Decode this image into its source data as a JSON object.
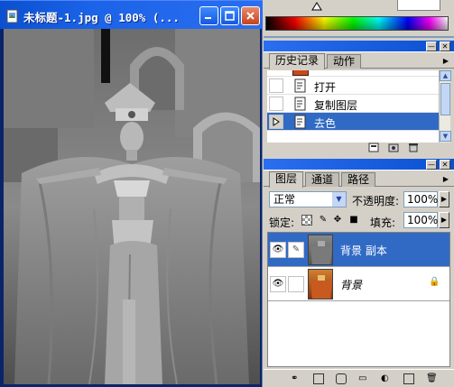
{
  "document": {
    "title": "未标题-1.jpg @ 100% (..."
  },
  "history": {
    "tabs": [
      "历史记录",
      "动作"
    ],
    "items": [
      {
        "label": "打开",
        "selected": false
      },
      {
        "label": "复制图层",
        "selected": false
      },
      {
        "label": "去色",
        "selected": true
      }
    ]
  },
  "layers": {
    "tabs": [
      "图层",
      "通道",
      "路径"
    ],
    "blend_mode": "正常",
    "opacity_label": "不透明度:",
    "opacity_value": "100%",
    "lock_label": "锁定:",
    "fill_label": "填充:",
    "fill_value": "100%",
    "items": [
      {
        "name": "背景 副本",
        "selected": true,
        "locked": false
      },
      {
        "name": "背景",
        "selected": false,
        "locked": true
      }
    ]
  },
  "colors": {
    "titlebar": "#0a50d0",
    "selection": "#316ac5",
    "panel_bg": "#d4d0c8"
  }
}
